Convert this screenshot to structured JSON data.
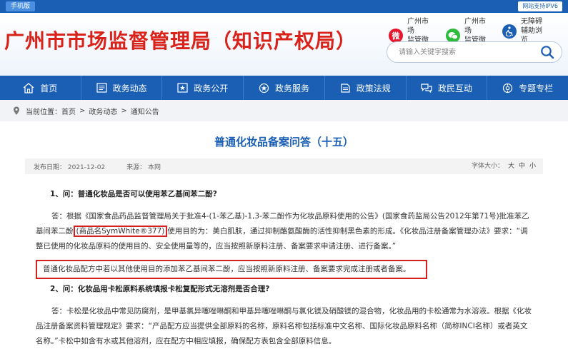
{
  "topbar": {
    "mobile_label": "手机版",
    "ipv6_label": "网站支持IPV6"
  },
  "header": {
    "title": "广州市市场监督管理局（知识产权局）",
    "weibo_label_1": "广州市场",
    "weibo_label_2": "监管微博",
    "wechat_label_1": "广州市场",
    "wechat_label_2": "监管微信",
    "access_label_1": "无障碍",
    "access_label_2": "辅助浏览",
    "search_placeholder": "请输入关键字搜索"
  },
  "nav": {
    "items": [
      {
        "label": "首页",
        "icon": "home-icon"
      },
      {
        "label": "政务动态",
        "icon": "news-icon"
      },
      {
        "label": "政务公开",
        "icon": "star-doc-icon"
      },
      {
        "label": "政务服务",
        "icon": "service-icon"
      },
      {
        "label": "政策法规",
        "icon": "law-icon"
      },
      {
        "label": "政民互动",
        "icon": "interact-icon"
      },
      {
        "label": "专题专栏",
        "icon": "topic-icon"
      }
    ]
  },
  "breadcrumb": {
    "prefix": "当前位置：",
    "home": "首页",
    "level1": "政务动态",
    "level2": "通知公告",
    "separator": ">"
  },
  "article": {
    "title": "普通化妆品备案问答（十五）",
    "date": "发布日期：  2021-12-02",
    "source": "来源：  本网",
    "font_label": "字体大小：",
    "font_large": "大",
    "font_medium": "中",
    "font_small": "小",
    "q1": "1、问：普通化妆品是否可以使用苯乙基间苯二酚?",
    "a1_part1": "答：根据《国家食品药品监督管理局关于批准4-(1-苯乙基)-1,3-苯二酚作为化妆品原料使用的公告》(国家食药监局公告2012年第71号)批准苯乙基间苯二酚",
    "a1_highlight": "(商品名SymWhite®377)",
    "a1_part2": "使用目的为：美白肌肤，通过抑制酪氨酸酶的活性抑制黑色素的形成。《化妆品注册备案管理办法》要求：“调整已使用的化妆品原料的使用目的、安全使用量等的，应当按照新原料注册、备案要求申请注册、进行备案。”",
    "a1_boxed": "普通化妆品配方中若以其他使用目的添加苯乙基间苯二酚，应当按照新原料注册、备案要求完成注册或者备案。",
    "q2": "2、问：化妆品用卡松原料系统填报卡松复配形式无溶剂是否合理?",
    "a2": "答：卡松是化妆品中常见防腐剂，是甲基氯异噻唑啉酮和甲基异噻唑啉酮与氯化镁及硝酸镁的混合物，化妆品用的卡松通常为水溶液。根据《化妆品注册备案资料管理规定》要求：“产品配方应当提供全部原料的名称，原料名称包括标准中文名称、国际化妆品原料名称（简称INCI名称）或者英文名称。”卡松中如含有水或其他溶剂，应在配方中相应填报，确保配方表包含全部原料信息。"
  },
  "colors": {
    "brand_blue": "#1a5fb4",
    "title_red": "#d9221a",
    "highlight_red": "#d62020"
  }
}
